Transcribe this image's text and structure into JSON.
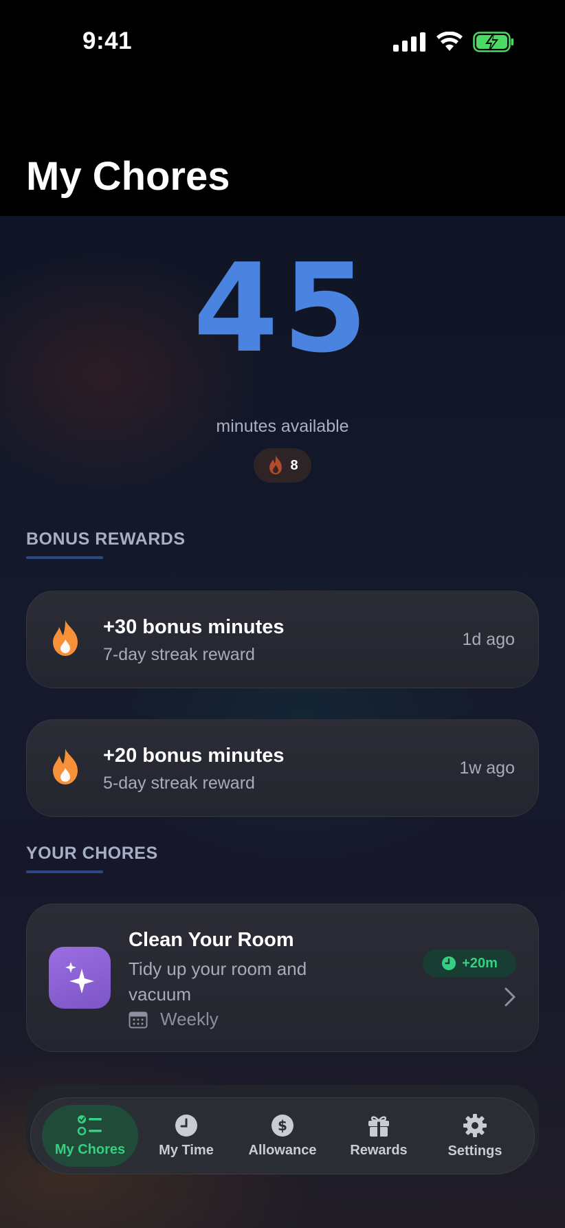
{
  "status_bar": {
    "time": "9:41"
  },
  "header": {
    "title": "My Chores"
  },
  "summary": {
    "minutes": "45",
    "minutes_label": "minutes available",
    "streak_count": "8"
  },
  "bonus_section": {
    "title": "BONUS REWARDS",
    "items": [
      {
        "title": "+30 bonus minutes",
        "subtitle": "7-day streak reward",
        "time": "1d ago",
        "icon": "flame-icon"
      },
      {
        "title": "+20 bonus minutes",
        "subtitle": "5-day streak reward",
        "time": "1w ago",
        "icon": "flame-icon"
      }
    ]
  },
  "chores_section": {
    "title": "YOUR CHORES",
    "items": [
      {
        "title": "Clean Your Room",
        "description": "Tidy up your room and vacuum",
        "frequency": "Weekly",
        "reward": "+20m",
        "icon": "sparkles-icon"
      }
    ]
  },
  "tab_bar": {
    "active": "My Chores",
    "items": [
      {
        "label": "My Chores",
        "icon": "checklist-icon"
      },
      {
        "label": "My Time",
        "icon": "clock-icon"
      },
      {
        "label": "Allowance",
        "icon": "dollar-icon"
      },
      {
        "label": "Rewards",
        "icon": "gift-icon"
      },
      {
        "label": "Settings",
        "icon": "gear-icon"
      }
    ]
  },
  "colors": {
    "accent_blue": "#4a84e0",
    "accent_green": "#35d082",
    "flame_orange": "#f6913a",
    "chore_purple": "#8b63d6"
  }
}
